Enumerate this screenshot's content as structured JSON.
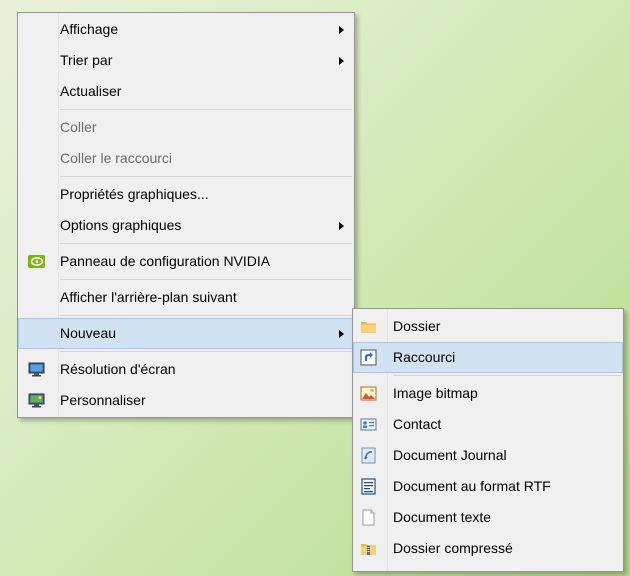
{
  "main_menu": {
    "items": [
      {
        "label": "Affichage"
      },
      {
        "label": "Trier par"
      },
      {
        "label": "Actualiser"
      },
      {
        "label": "Coller"
      },
      {
        "label": "Coller le raccourci"
      },
      {
        "label": "Propriétés graphiques..."
      },
      {
        "label": "Options graphiques"
      },
      {
        "label": "Panneau de configuration NVIDIA",
        "icon": "nvidia-icon"
      },
      {
        "label": "Afficher l'arrière-plan suivant"
      },
      {
        "label": "Nouveau"
      },
      {
        "label": "Résolution d'écran",
        "icon": "display-icon"
      },
      {
        "label": "Personnaliser",
        "icon": "personalize-icon"
      }
    ]
  },
  "submenu_nouveau": {
    "items": [
      {
        "label": "Dossier",
        "icon": "folder-icon"
      },
      {
        "label": "Raccourci",
        "icon": "shortcut-icon"
      },
      {
        "label": "Image bitmap",
        "icon": "bitmap-icon"
      },
      {
        "label": "Contact",
        "icon": "contact-icon"
      },
      {
        "label": "Document Journal",
        "icon": "journal-icon"
      },
      {
        "label": "Document au format RTF",
        "icon": "rtf-icon"
      },
      {
        "label": "Document texte",
        "icon": "text-document-icon"
      },
      {
        "label": "Dossier compressé",
        "icon": "zip-folder-icon"
      }
    ]
  }
}
